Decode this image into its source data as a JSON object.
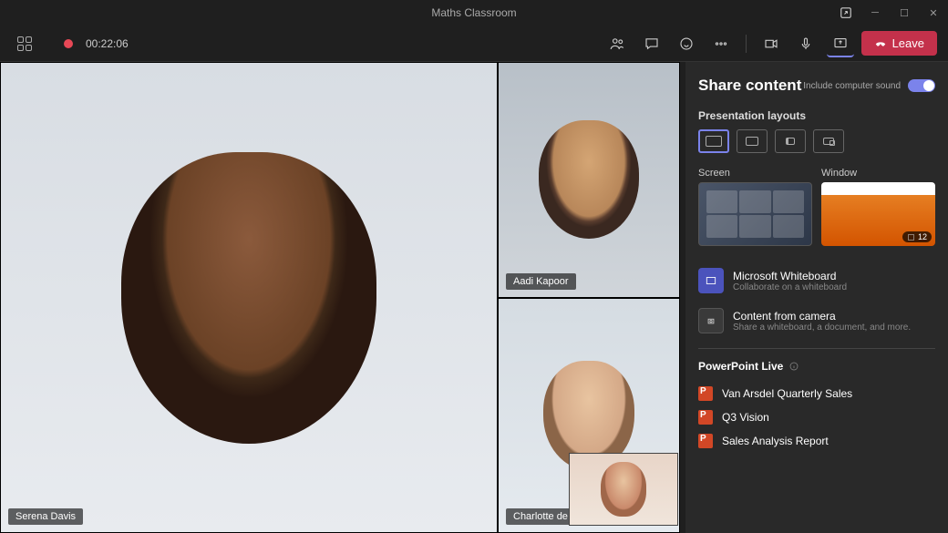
{
  "window": {
    "title": "Maths Classroom"
  },
  "recording": {
    "time": "00:22:06"
  },
  "leave_label": "Leave",
  "participants": [
    {
      "name": "Serena Davis"
    },
    {
      "name": "Aadi Kapoor"
    },
    {
      "name": "Charlotte de Crum"
    }
  ],
  "share": {
    "title": "Share content",
    "sound_label": "Include computer sound",
    "layouts_label": "Presentation layouts",
    "screen_label": "Screen",
    "window_label": "Window",
    "window_count": "12",
    "whiteboard": {
      "title": "Microsoft Whiteboard",
      "sub": "Collaborate on a whiteboard"
    },
    "camera": {
      "title": "Content from camera",
      "sub": "Share a whiteboard, a document, and more."
    },
    "ppl_label": "PowerPoint Live",
    "files": [
      "Van Arsdel Quarterly Sales",
      "Q3 Vision",
      "Sales Analysis Report"
    ]
  }
}
